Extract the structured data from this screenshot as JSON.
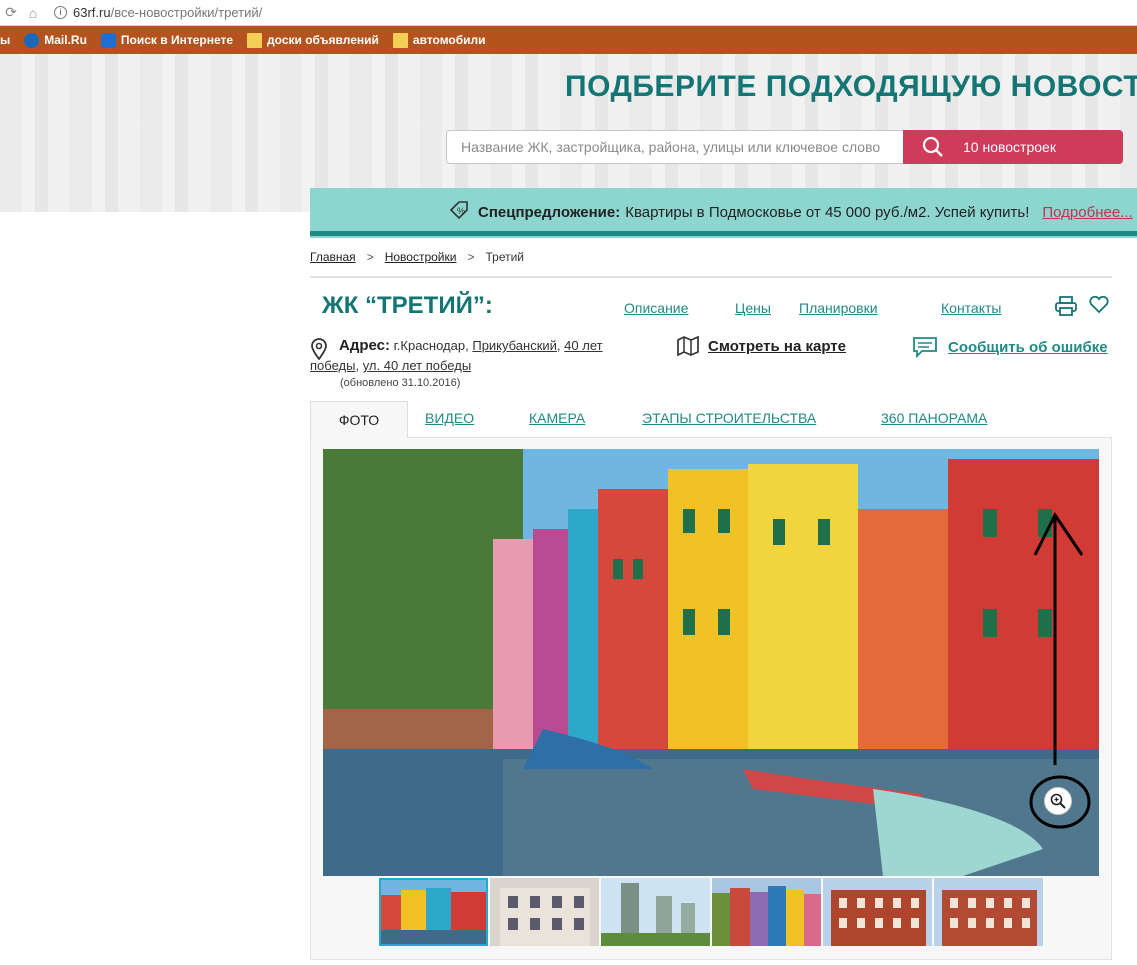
{
  "browser": {
    "url_host": "63rf.ru",
    "url_path": "/все-новостройки/третий/",
    "bookmarks": [
      {
        "label": "ы",
        "icon": "none"
      },
      {
        "label": "Mail.Ru",
        "icon": "mail-icon"
      },
      {
        "label": "Поиск в Интернете",
        "icon": "search-icon"
      },
      {
        "label": "доски объявлений",
        "icon": "folder-icon"
      },
      {
        "label": "автомобили",
        "icon": "folder-icon"
      }
    ]
  },
  "hero": {
    "title": "ПОДБЕРИТЕ ПОДХОДЯЩУЮ НОВОСТРО",
    "search_placeholder": "Название ЖК, застройщика, района, улицы или ключевое слово",
    "search_button": "10 новостроек"
  },
  "promo": {
    "label": "Спецпредложение:",
    "text": "Квартиры в Подмосковье от 45 000 руб./м2. Успей купить!",
    "more": "Подробнее..."
  },
  "breadcrumb": {
    "home": "Главная",
    "sep": ">",
    "section": "Новостройки",
    "current": "Третий"
  },
  "object": {
    "title": "ЖК “ТРЕТИЙ”:",
    "nav": [
      "Описание",
      "Цены",
      "Планировки",
      "Контакты"
    ],
    "address_label": "Адрес:",
    "address_city": "г.Краснодар,",
    "address_district": "Прикубанский,",
    "address_street1": "40 лет",
    "address_street2": "победы,",
    "address_street3": "ул. 40 лет победы",
    "updated": "(обновлено 31.10.2016)",
    "map_link": "Смотреть на карте",
    "error_link": "Сообщить об ошибке"
  },
  "tabs": [
    "ФОТО",
    "ВИДЕО",
    "КАМЕРА",
    "ЭТАПЫ СТРОИТЕЛЬСТВА",
    "360 ПАНОРАМА"
  ],
  "colors": {
    "teal": "#137674",
    "pink": "#cf3b5a",
    "bookmark_bar": "#b5531e",
    "promo_bg": "#8dd5cf"
  }
}
